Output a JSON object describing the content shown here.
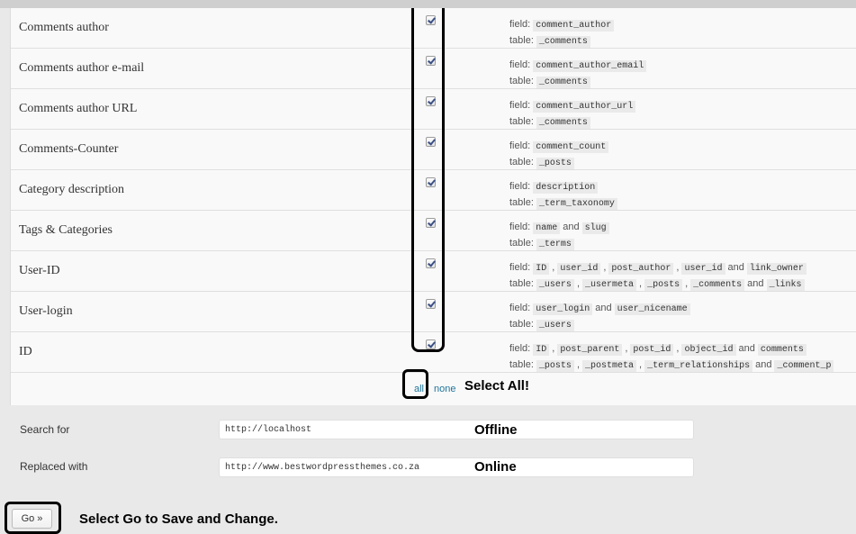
{
  "rows": [
    {
      "label": "Comments author",
      "checked": true,
      "fields": [
        "comment_author"
      ],
      "tables": [
        "_comments"
      ]
    },
    {
      "label": "Comments author e-mail",
      "checked": true,
      "fields": [
        "comment_author_email"
      ],
      "tables": [
        "_comments"
      ]
    },
    {
      "label": "Comments author URL",
      "checked": true,
      "fields": [
        "comment_author_url"
      ],
      "tables": [
        "_comments"
      ]
    },
    {
      "label": "Comments-Counter",
      "checked": true,
      "fields": [
        "comment_count"
      ],
      "tables": [
        "_posts"
      ]
    },
    {
      "label": "Category description",
      "checked": true,
      "fields": [
        "description"
      ],
      "tables": [
        "_term_taxonomy"
      ]
    },
    {
      "label": "Tags & Categories",
      "checked": true,
      "fields": [
        "name",
        "slug"
      ],
      "tables": [
        "_terms"
      ]
    },
    {
      "label": "User-ID",
      "checked": true,
      "fields": [
        "ID",
        "user_id",
        "post_author",
        "user_id",
        "link_owner"
      ],
      "tables": [
        "_users",
        "_usermeta",
        "_posts",
        "_comments",
        "_links"
      ]
    },
    {
      "label": "User-login",
      "checked": true,
      "fields": [
        "user_login",
        "user_nicename"
      ],
      "tables": [
        "_users"
      ]
    },
    {
      "label": "ID",
      "checked": true,
      "fields": [
        "ID",
        "post_parent",
        "post_id",
        "object_id",
        "comments"
      ],
      "tables": [
        "_posts",
        "_postmeta",
        "_term_relationships",
        "_comment_p"
      ]
    }
  ],
  "text": {
    "field_label": "field:",
    "table_label": "table:",
    "and_word": "and",
    "list_separator": ","
  },
  "selection": {
    "all_label": "all",
    "none_label": "none"
  },
  "annotations": {
    "select_all": "Select All!",
    "offline": "Offline",
    "online": "Online",
    "go_note": "Select Go to Save and Change."
  },
  "form": {
    "search_label": "Search for",
    "search_value": "http://localhost",
    "replace_label": "Replaced with",
    "replace_value": "http://www.bestwordpressthemes.co.za",
    "go_label": "Go »"
  },
  "colors": {
    "link": "#21759b",
    "annotation_outline": "#000000",
    "checkbox_check": "#3a4f86"
  }
}
